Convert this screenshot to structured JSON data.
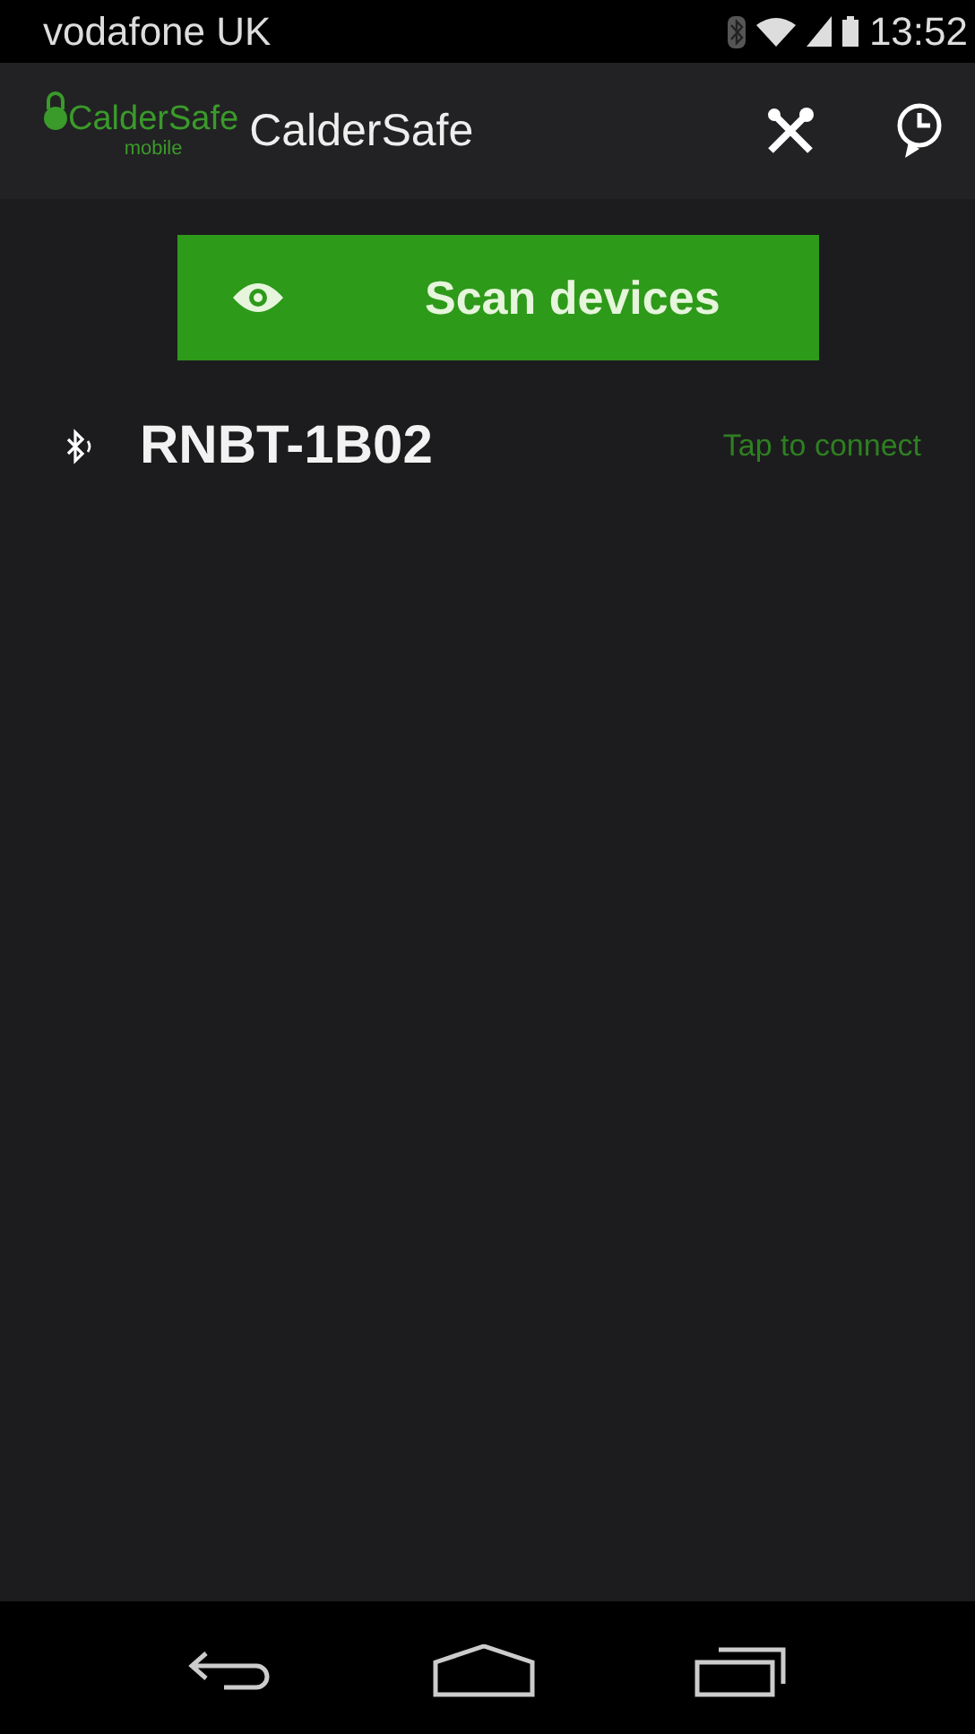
{
  "status_bar": {
    "carrier": "vodafone UK",
    "time": "13:52"
  },
  "action_bar": {
    "logo_text": "CalderSafe",
    "logo_subtext": "mobile",
    "title": "CalderSafe"
  },
  "scan_button": {
    "label": "Scan devices"
  },
  "devices": [
    {
      "name": "RNBT-1B02",
      "action": "Tap to connect"
    }
  ]
}
